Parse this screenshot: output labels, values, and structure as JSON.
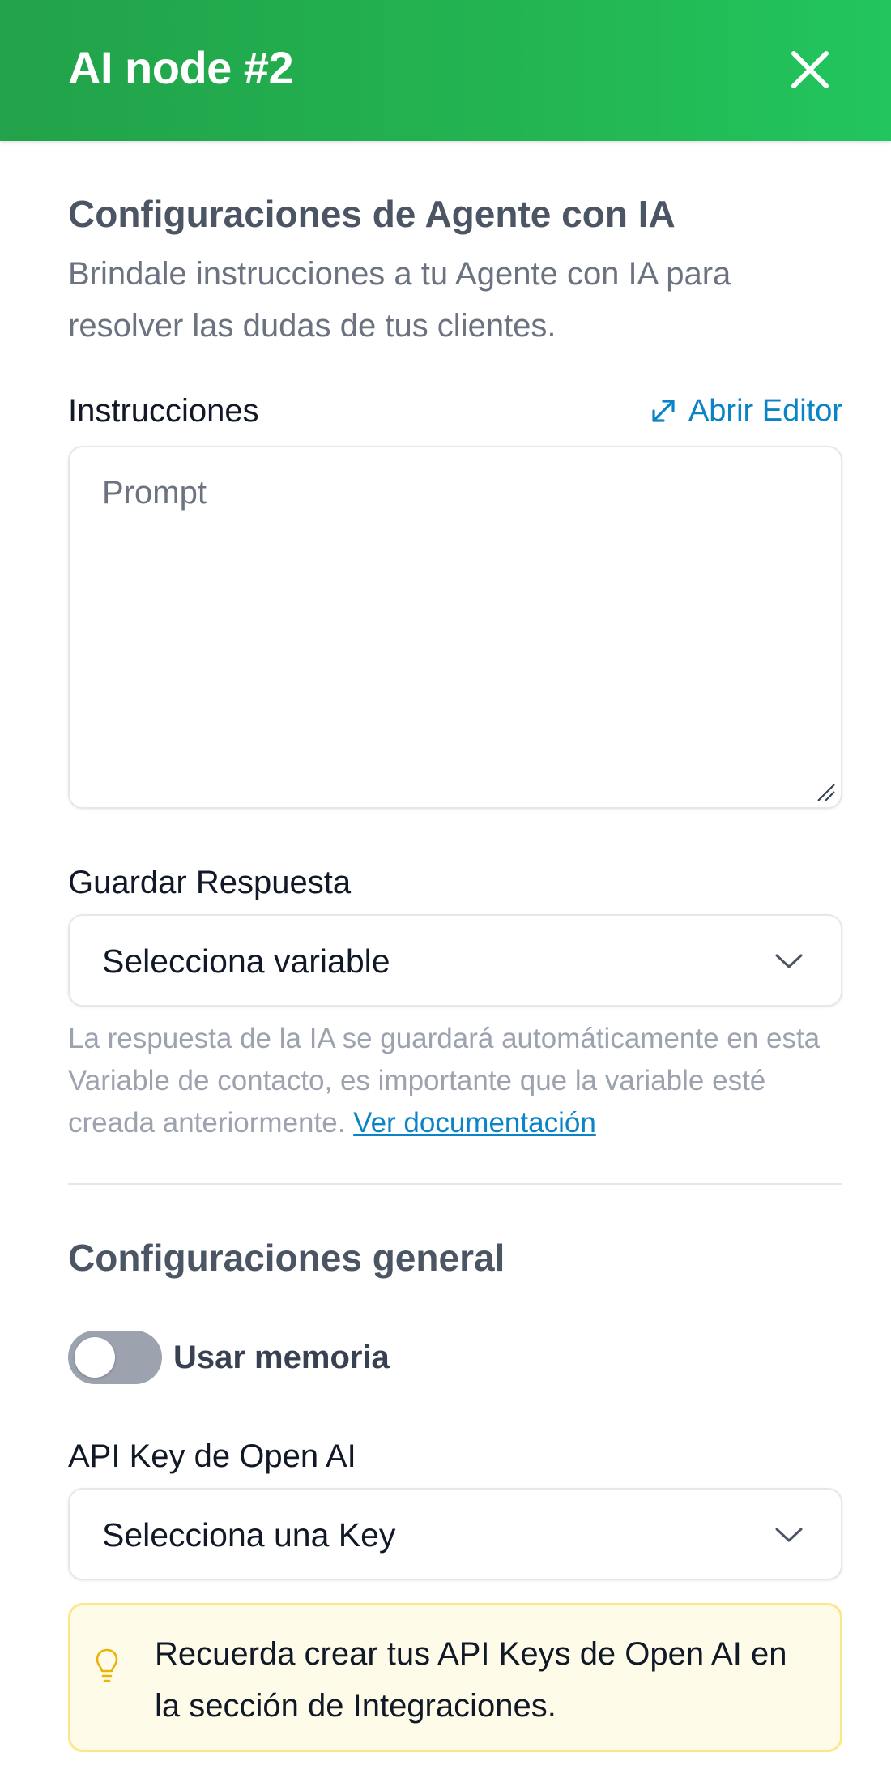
{
  "header": {
    "title": "AI node #2",
    "close_icon": "close-icon"
  },
  "agent_config": {
    "title": "Configuraciones de Agente con IA",
    "description": "Brindale instrucciones a tu Agente con IA para resolver las dudas de tus clientes."
  },
  "instructions": {
    "label": "Instrucciones",
    "editor_link": "Abrir Editor",
    "editor_icon": "expand-icon",
    "placeholder": "Prompt",
    "value": ""
  },
  "save_response": {
    "label": "Guardar Respuesta",
    "selected": "Selecciona variable",
    "help_text": "La respuesta de la IA se guardará automáticamente en esta Variable de contacto, es importante que la variable esté creada anteriormente.",
    "doc_link": "Ver documentación"
  },
  "general_config": {
    "title": "Configuraciones general",
    "memory_toggle": {
      "label": "Usar memoria",
      "enabled": false
    },
    "api_key": {
      "label": "API Key de Open AI",
      "selected": "Selecciona una Key"
    },
    "info": {
      "icon": "lightbulb-icon",
      "text": "Recuerda crear tus API Keys de Open AI en la sección de Integraciones."
    }
  },
  "colors": {
    "header_green": "#22b04f",
    "link_blue": "#0a84c6",
    "info_bg": "#fefce8",
    "info_border": "#fde68a"
  }
}
